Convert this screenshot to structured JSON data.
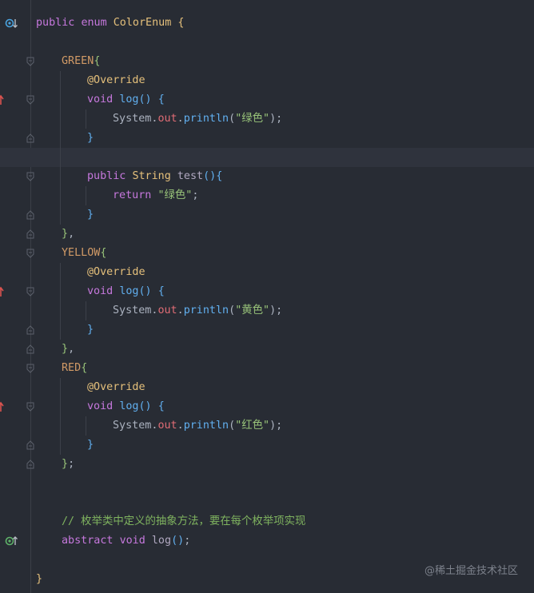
{
  "editor": {
    "background": "#282c34",
    "lines": [
      {
        "indent": 0,
        "tokens": [
          [
            "kw",
            "public"
          ],
          [
            "pn",
            " "
          ],
          [
            "kw",
            "enum"
          ],
          [
            "pn",
            " "
          ],
          [
            "cl",
            "ColorEnum"
          ],
          [
            "pn",
            " "
          ],
          [
            "br1",
            "{"
          ]
        ],
        "marker": "implements-icon"
      },
      {
        "indent": 0,
        "tokens": []
      },
      {
        "indent": 1,
        "tokens": [
          [
            "ec",
            "GREEN"
          ],
          [
            "br2",
            "{"
          ]
        ],
        "fold": "open"
      },
      {
        "indent": 2,
        "tokens": [
          [
            "an",
            "@Override"
          ]
        ]
      },
      {
        "indent": 2,
        "tokens": [
          [
            "kw",
            "void"
          ],
          [
            "pn",
            " "
          ],
          [
            "fn",
            "log"
          ],
          [
            "br3",
            "()"
          ],
          [
            "pn",
            " "
          ],
          [
            "br3",
            "{"
          ]
        ],
        "marker": "override-icon",
        "fold": "open"
      },
      {
        "indent": 3,
        "tokens": [
          [
            "pn",
            "System."
          ],
          [
            "fld",
            "out"
          ],
          [
            "pn",
            "."
          ],
          [
            "fn",
            "println"
          ],
          [
            "pn",
            "("
          ],
          [
            "st",
            "\"绿色\""
          ],
          [
            "pn",
            ");"
          ]
        ]
      },
      {
        "indent": 2,
        "tokens": [
          [
            "br3",
            "}"
          ]
        ],
        "fold": "close"
      },
      {
        "indent": 2,
        "tokens": [],
        "current": true
      },
      {
        "indent": 2,
        "tokens": [
          [
            "kw",
            "public"
          ],
          [
            "pn",
            " "
          ],
          [
            "ty",
            "String"
          ],
          [
            "pn",
            " "
          ],
          [
            "mt",
            "test"
          ],
          [
            "br3",
            "(){"
          ]
        ],
        "fold": "open"
      },
      {
        "indent": 3,
        "tokens": [
          [
            "kw",
            "return"
          ],
          [
            "pn",
            " "
          ],
          [
            "st",
            "\"绿色\""
          ],
          [
            "pn",
            ";"
          ]
        ]
      },
      {
        "indent": 2,
        "tokens": [
          [
            "br3",
            "}"
          ]
        ],
        "fold": "close"
      },
      {
        "indent": 1,
        "tokens": [
          [
            "br2",
            "}"
          ],
          [
            "pn",
            ","
          ]
        ],
        "fold": "close"
      },
      {
        "indent": 1,
        "tokens": [
          [
            "ec",
            "YELLOW"
          ],
          [
            "br2",
            "{"
          ]
        ],
        "fold": "open"
      },
      {
        "indent": 2,
        "tokens": [
          [
            "an",
            "@Override"
          ]
        ]
      },
      {
        "indent": 2,
        "tokens": [
          [
            "kw",
            "void"
          ],
          [
            "pn",
            " "
          ],
          [
            "fn",
            "log"
          ],
          [
            "br3",
            "()"
          ],
          [
            "pn",
            " "
          ],
          [
            "br3",
            "{"
          ]
        ],
        "marker": "override-icon",
        "fold": "open"
      },
      {
        "indent": 3,
        "tokens": [
          [
            "pn",
            "System."
          ],
          [
            "fld",
            "out"
          ],
          [
            "pn",
            "."
          ],
          [
            "fn",
            "println"
          ],
          [
            "pn",
            "("
          ],
          [
            "st",
            "\"黄色\""
          ],
          [
            "pn",
            ");"
          ]
        ]
      },
      {
        "indent": 2,
        "tokens": [
          [
            "br3",
            "}"
          ]
        ],
        "fold": "close"
      },
      {
        "indent": 1,
        "tokens": [
          [
            "br2",
            "}"
          ],
          [
            "pn",
            ","
          ]
        ],
        "fold": "close"
      },
      {
        "indent": 1,
        "tokens": [
          [
            "ec",
            "RED"
          ],
          [
            "br2",
            "{"
          ]
        ],
        "fold": "open"
      },
      {
        "indent": 2,
        "tokens": [
          [
            "an",
            "@Override"
          ]
        ]
      },
      {
        "indent": 2,
        "tokens": [
          [
            "kw",
            "void"
          ],
          [
            "pn",
            " "
          ],
          [
            "fn",
            "log"
          ],
          [
            "br3",
            "()"
          ],
          [
            "pn",
            " "
          ],
          [
            "br3",
            "{"
          ]
        ],
        "marker": "override-icon",
        "fold": "open"
      },
      {
        "indent": 3,
        "tokens": [
          [
            "pn",
            "System."
          ],
          [
            "fld",
            "out"
          ],
          [
            "pn",
            "."
          ],
          [
            "fn",
            "println"
          ],
          [
            "pn",
            "("
          ],
          [
            "st",
            "\"红色\""
          ],
          [
            "pn",
            ");"
          ]
        ]
      },
      {
        "indent": 2,
        "tokens": [
          [
            "br3",
            "}"
          ]
        ],
        "fold": "close"
      },
      {
        "indent": 1,
        "tokens": [
          [
            "br2",
            "}"
          ],
          [
            "pn",
            ";"
          ]
        ],
        "fold": "close"
      },
      {
        "indent": 0,
        "tokens": []
      },
      {
        "indent": 0,
        "tokens": []
      },
      {
        "indent": 1,
        "tokens": [
          [
            "cm",
            "// 枚举类中定义的抽象方法，要在每个枚举项实现"
          ]
        ]
      },
      {
        "indent": 1,
        "tokens": [
          [
            "kw",
            "abstract"
          ],
          [
            "pn",
            " "
          ],
          [
            "kw",
            "void"
          ],
          [
            "pn",
            " "
          ],
          [
            "mt",
            "log"
          ],
          [
            "br3",
            "()"
          ],
          [
            "pn",
            ";"
          ]
        ],
        "marker": "implemented-icon"
      },
      {
        "indent": 0,
        "tokens": []
      },
      {
        "indent": 0,
        "tokens": [
          [
            "br1",
            "}"
          ]
        ]
      }
    ]
  },
  "watermark": "@稀土掘金技术社区"
}
